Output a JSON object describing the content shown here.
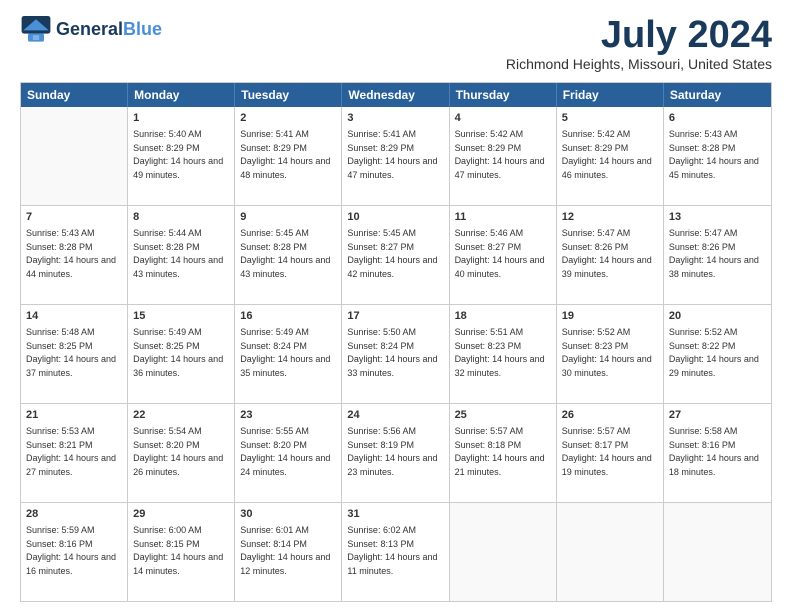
{
  "header": {
    "logo_line1": "General",
    "logo_line2": "Blue",
    "title": "July 2024",
    "subtitle": "Richmond Heights, Missouri, United States"
  },
  "calendar": {
    "days": [
      "Sunday",
      "Monday",
      "Tuesday",
      "Wednesday",
      "Thursday",
      "Friday",
      "Saturday"
    ],
    "rows": [
      [
        {
          "day": "",
          "empty": true
        },
        {
          "day": "1",
          "sunrise": "5:40 AM",
          "sunset": "8:29 PM",
          "daylight": "14 hours and 49 minutes."
        },
        {
          "day": "2",
          "sunrise": "5:41 AM",
          "sunset": "8:29 PM",
          "daylight": "14 hours and 48 minutes."
        },
        {
          "day": "3",
          "sunrise": "5:41 AM",
          "sunset": "8:29 PM",
          "daylight": "14 hours and 47 minutes."
        },
        {
          "day": "4",
          "sunrise": "5:42 AM",
          "sunset": "8:29 PM",
          "daylight": "14 hours and 47 minutes."
        },
        {
          "day": "5",
          "sunrise": "5:42 AM",
          "sunset": "8:29 PM",
          "daylight": "14 hours and 46 minutes."
        },
        {
          "day": "6",
          "sunrise": "5:43 AM",
          "sunset": "8:28 PM",
          "daylight": "14 hours and 45 minutes."
        }
      ],
      [
        {
          "day": "7",
          "sunrise": "5:43 AM",
          "sunset": "8:28 PM",
          "daylight": "14 hours and 44 minutes."
        },
        {
          "day": "8",
          "sunrise": "5:44 AM",
          "sunset": "8:28 PM",
          "daylight": "14 hours and 43 minutes."
        },
        {
          "day": "9",
          "sunrise": "5:45 AM",
          "sunset": "8:28 PM",
          "daylight": "14 hours and 43 minutes."
        },
        {
          "day": "10",
          "sunrise": "5:45 AM",
          "sunset": "8:27 PM",
          "daylight": "14 hours and 42 minutes."
        },
        {
          "day": "11",
          "sunrise": "5:46 AM",
          "sunset": "8:27 PM",
          "daylight": "14 hours and 40 minutes."
        },
        {
          "day": "12",
          "sunrise": "5:47 AM",
          "sunset": "8:26 PM",
          "daylight": "14 hours and 39 minutes."
        },
        {
          "day": "13",
          "sunrise": "5:47 AM",
          "sunset": "8:26 PM",
          "daylight": "14 hours and 38 minutes."
        }
      ],
      [
        {
          "day": "14",
          "sunrise": "5:48 AM",
          "sunset": "8:25 PM",
          "daylight": "14 hours and 37 minutes."
        },
        {
          "day": "15",
          "sunrise": "5:49 AM",
          "sunset": "8:25 PM",
          "daylight": "14 hours and 36 minutes."
        },
        {
          "day": "16",
          "sunrise": "5:49 AM",
          "sunset": "8:24 PM",
          "daylight": "14 hours and 35 minutes."
        },
        {
          "day": "17",
          "sunrise": "5:50 AM",
          "sunset": "8:24 PM",
          "daylight": "14 hours and 33 minutes."
        },
        {
          "day": "18",
          "sunrise": "5:51 AM",
          "sunset": "8:23 PM",
          "daylight": "14 hours and 32 minutes."
        },
        {
          "day": "19",
          "sunrise": "5:52 AM",
          "sunset": "8:23 PM",
          "daylight": "14 hours and 30 minutes."
        },
        {
          "day": "20",
          "sunrise": "5:52 AM",
          "sunset": "8:22 PM",
          "daylight": "14 hours and 29 minutes."
        }
      ],
      [
        {
          "day": "21",
          "sunrise": "5:53 AM",
          "sunset": "8:21 PM",
          "daylight": "14 hours and 27 minutes."
        },
        {
          "day": "22",
          "sunrise": "5:54 AM",
          "sunset": "8:20 PM",
          "daylight": "14 hours and 26 minutes."
        },
        {
          "day": "23",
          "sunrise": "5:55 AM",
          "sunset": "8:20 PM",
          "daylight": "14 hours and 24 minutes."
        },
        {
          "day": "24",
          "sunrise": "5:56 AM",
          "sunset": "8:19 PM",
          "daylight": "14 hours and 23 minutes."
        },
        {
          "day": "25",
          "sunrise": "5:57 AM",
          "sunset": "8:18 PM",
          "daylight": "14 hours and 21 minutes."
        },
        {
          "day": "26",
          "sunrise": "5:57 AM",
          "sunset": "8:17 PM",
          "daylight": "14 hours and 19 minutes."
        },
        {
          "day": "27",
          "sunrise": "5:58 AM",
          "sunset": "8:16 PM",
          "daylight": "14 hours and 18 minutes."
        }
      ],
      [
        {
          "day": "28",
          "sunrise": "5:59 AM",
          "sunset": "8:16 PM",
          "daylight": "14 hours and 16 minutes."
        },
        {
          "day": "29",
          "sunrise": "6:00 AM",
          "sunset": "8:15 PM",
          "daylight": "14 hours and 14 minutes."
        },
        {
          "day": "30",
          "sunrise": "6:01 AM",
          "sunset": "8:14 PM",
          "daylight": "14 hours and 12 minutes."
        },
        {
          "day": "31",
          "sunrise": "6:02 AM",
          "sunset": "8:13 PM",
          "daylight": "14 hours and 11 minutes."
        },
        {
          "day": "",
          "empty": true
        },
        {
          "day": "",
          "empty": true
        },
        {
          "day": "",
          "empty": true
        }
      ]
    ]
  }
}
